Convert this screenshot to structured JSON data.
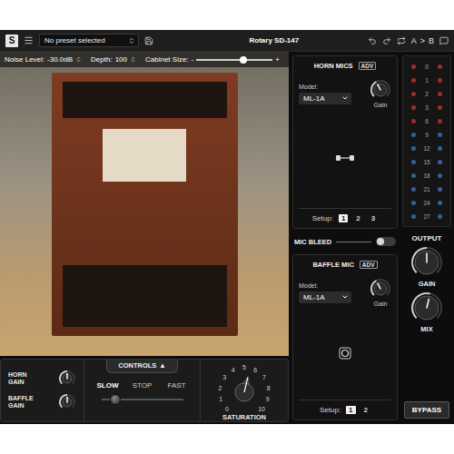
{
  "header": {
    "logo": "S",
    "preset": "No preset selected",
    "title": "Rotary SD-147",
    "compare_a": "A",
    "compare_arrow": ">",
    "compare_b": "B"
  },
  "top_controls": {
    "noise_label": "Noise Level:",
    "noise_value": "-30.0dB",
    "depth_label": "Depth:",
    "depth_value": "100",
    "cabinet_label": "Cabinet Size:",
    "cabinet_minus": "-",
    "cabinet_plus": "+",
    "cabinet_level": 0.62
  },
  "horn_mics": {
    "title": "HORN MICS",
    "badge": "ADV",
    "model_label": "Model:",
    "model": "ML-1A",
    "gain_label": "Gain",
    "gain_level": 0.4,
    "setup_label": "Setup:",
    "setups": [
      {
        "label": "1",
        "selected": true
      },
      {
        "label": "2",
        "selected": false
      },
      {
        "label": "3",
        "selected": false
      }
    ]
  },
  "mic_bleed": {
    "label": "MIC BLEED",
    "on": false
  },
  "baffle_mic": {
    "title": "BAFFLE MIC",
    "badge": "ADV",
    "model_label": "Model:",
    "model": "ML-1A",
    "gain_label": "Gain",
    "gain_level": 0.4,
    "setup_label": "Setup:",
    "setups": [
      {
        "label": "1",
        "selected": true
      },
      {
        "label": "2",
        "selected": false
      }
    ]
  },
  "meter": {
    "rows": [
      {
        "label": "0",
        "color": "#b8302a"
      },
      {
        "label": "1",
        "color": "#b8302a"
      },
      {
        "label": "2",
        "color": "#b8302a"
      },
      {
        "label": "3",
        "color": "#b8302a"
      },
      {
        "label": "6",
        "color": "#b8302a"
      },
      {
        "label": "9",
        "color": "#3a6fb0"
      },
      {
        "label": "12",
        "color": "#3a6fb0"
      },
      {
        "label": "15",
        "color": "#3a6fb0"
      },
      {
        "label": "18",
        "color": "#3a6fb0"
      },
      {
        "label": "21",
        "color": "#3a6fb0"
      },
      {
        "label": "24",
        "color": "#3a6fb0"
      },
      {
        "label": "27",
        "color": "#3a6fb0"
      }
    ]
  },
  "output": {
    "title": "OUTPUT",
    "gain_label": "GAIN",
    "gain_level": 0.5,
    "mix_label": "MIX",
    "mix_level": 0.55,
    "bypass": "BYPASS"
  },
  "bottom": {
    "gains": [
      {
        "label_lines": [
          "HORN",
          "GAIN"
        ],
        "level": 0.5
      },
      {
        "label_lines": [
          "BAFFLE",
          "GAIN"
        ],
        "level": 0.5
      }
    ],
    "controls_title": "CONTROLS",
    "controls_arrow": "▲",
    "speeds": [
      {
        "label": "SLOW",
        "selected": true
      },
      {
        "label": "STOP",
        "selected": false
      },
      {
        "label": "FAST",
        "selected": false
      }
    ],
    "saturation": {
      "label": "SATURATION",
      "level": 0.55,
      "ticks": [
        "0",
        "1",
        "2",
        "3",
        "4",
        "5",
        "6",
        "7",
        "8",
        "9",
        "10"
      ]
    }
  }
}
